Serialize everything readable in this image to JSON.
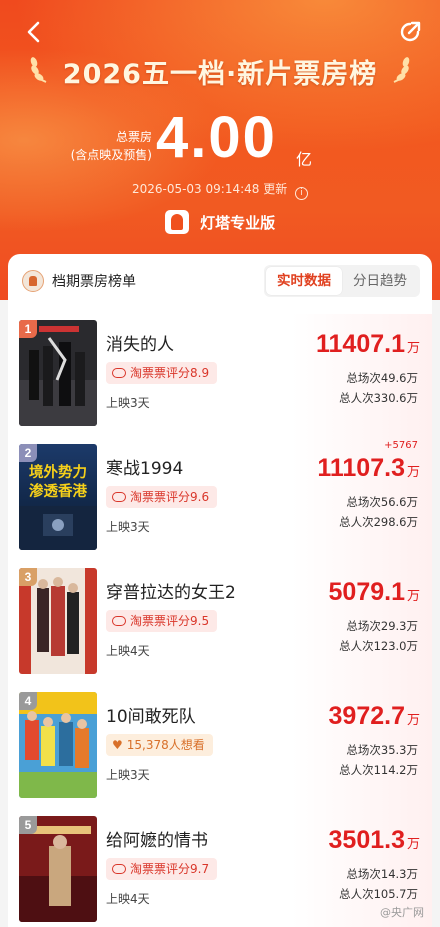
{
  "header": {
    "title": "2026五一档·新片票房榜",
    "total_label_line1": "总票房",
    "total_label_line2": "(含点映及预售)",
    "total_value": "4.00",
    "total_unit": "亿",
    "update_time": "2026-05-03 09:14:48 更新",
    "info_glyph": "i",
    "brand": "灯塔专业版",
    "back_glyph": "‹"
  },
  "card": {
    "title": "档期票房榜单",
    "tabs": [
      "实时数据",
      "分日趋势"
    ],
    "active_tab": 0
  },
  "movies": [
    {
      "rank": "1",
      "title": "消失的人",
      "tag": "淘票票评分8.9",
      "tag_type": "rating",
      "release": "上映3天",
      "box": "11407.1",
      "unit": "万",
      "delta": "",
      "shows": "总场次49.6万",
      "viewers": "总人次330.6万",
      "badge_color": "#e86a4a"
    },
    {
      "rank": "2",
      "title": "寒战1994",
      "tag": "淘票票评分9.6",
      "tag_type": "rating",
      "release": "上映3天",
      "box": "11107.3",
      "unit": "万",
      "delta": "+5767",
      "shows": "总场次56.6万",
      "viewers": "总人次298.6万",
      "badge_color": "#8c8fb8",
      "poster_text": "境外势力 渗透香港"
    },
    {
      "rank": "3",
      "title": "穿普拉达的女王2",
      "tag": "淘票票评分9.5",
      "tag_type": "rating",
      "release": "上映4天",
      "box": "5079.1",
      "unit": "万",
      "delta": "",
      "shows": "总场次29.3万",
      "viewers": "总人次123.0万",
      "badge_color": "#d9a066"
    },
    {
      "rank": "4",
      "title": "10间敢死队",
      "tag": "15,378人想看",
      "tag_type": "want",
      "release": "上映3天",
      "box": "3972.7",
      "unit": "万",
      "delta": "",
      "shows": "总场次35.3万",
      "viewers": "总人次114.2万",
      "badge_color": "#9a9a9a"
    },
    {
      "rank": "5",
      "title": "给阿嬷的情书",
      "tag": "淘票票评分9.7",
      "tag_type": "rating",
      "release": "上映4天",
      "box": "3501.3",
      "unit": "万",
      "delta": "",
      "shows": "总场次14.3万",
      "viewers": "总人次105.7万",
      "badge_color": "#9a9a9a"
    }
  ],
  "watermark": "@央广网",
  "colors": {
    "accent": "#e01f1f",
    "hero": "#f2581f",
    "tab_active": "#e0401f"
  }
}
